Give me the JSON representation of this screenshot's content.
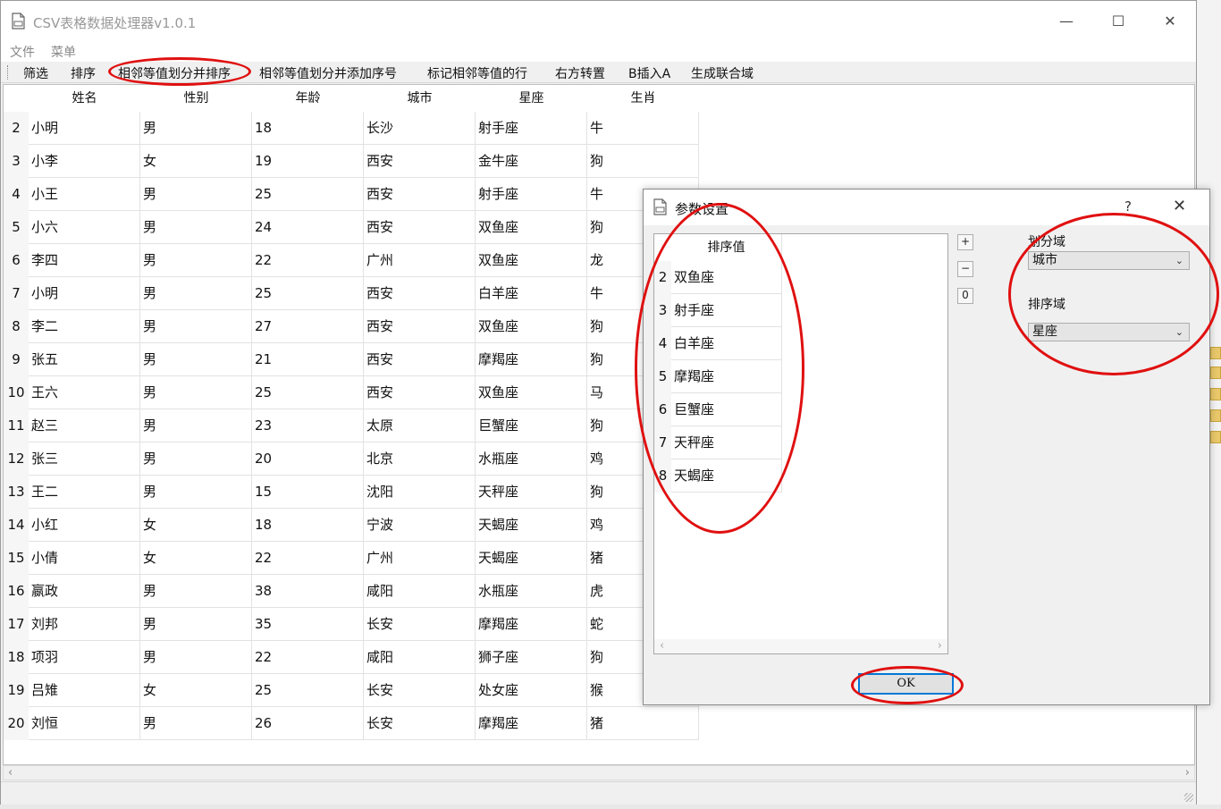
{
  "window": {
    "title": "CSV表格数据处理器v1.0.1",
    "controls": {
      "minimize": "—",
      "maximize": "☐",
      "close": "✕"
    }
  },
  "menu": [
    "文件",
    "菜单"
  ],
  "toolbar": [
    "筛选",
    "排序",
    "相邻等值划分并排序",
    "相邻等值划分并添加序号",
    "标记相邻等值的行",
    "右方转置",
    "B插入A",
    "生成联合域"
  ],
  "table": {
    "columns": [
      "姓名",
      "性别",
      "年龄",
      "城市",
      "星座",
      "生肖"
    ],
    "rows": [
      {
        "num": "2",
        "cells": [
          "小明",
          "男",
          "18",
          "长沙",
          "射手座",
          "牛"
        ]
      },
      {
        "num": "3",
        "cells": [
          "小李",
          "女",
          "19",
          "西安",
          "金牛座",
          "狗"
        ]
      },
      {
        "num": "4",
        "cells": [
          "小王",
          "男",
          "25",
          "西安",
          "射手座",
          "牛"
        ]
      },
      {
        "num": "5",
        "cells": [
          "小六",
          "男",
          "24",
          "西安",
          "双鱼座",
          "狗"
        ]
      },
      {
        "num": "6",
        "cells": [
          "李四",
          "男",
          "22",
          "广州",
          "双鱼座",
          "龙"
        ]
      },
      {
        "num": "7",
        "cells": [
          "小明",
          "男",
          "25",
          "西安",
          "白羊座",
          "牛"
        ]
      },
      {
        "num": "8",
        "cells": [
          "李二",
          "男",
          "27",
          "西安",
          "双鱼座",
          "狗"
        ]
      },
      {
        "num": "9",
        "cells": [
          "张五",
          "男",
          "21",
          "西安",
          "摩羯座",
          "狗"
        ]
      },
      {
        "num": "10",
        "cells": [
          "王六",
          "男",
          "25",
          "西安",
          "双鱼座",
          "马"
        ]
      },
      {
        "num": "11",
        "cells": [
          "赵三",
          "男",
          "23",
          "太原",
          "巨蟹座",
          "狗"
        ]
      },
      {
        "num": "12",
        "cells": [
          "张三",
          "男",
          "20",
          "北京",
          "水瓶座",
          "鸡"
        ]
      },
      {
        "num": "13",
        "cells": [
          "王二",
          "男",
          "15",
          "沈阳",
          "天秤座",
          "狗"
        ]
      },
      {
        "num": "14",
        "cells": [
          "小红",
          "女",
          "18",
          "宁波",
          "天蝎座",
          "鸡"
        ]
      },
      {
        "num": "15",
        "cells": [
          "小倩",
          "女",
          "22",
          "广州",
          "天蝎座",
          "猪"
        ]
      },
      {
        "num": "16",
        "cells": [
          "嬴政",
          "男",
          "38",
          "咸阳",
          "水瓶座",
          "虎"
        ]
      },
      {
        "num": "17",
        "cells": [
          "刘邦",
          "男",
          "35",
          "长安",
          "摩羯座",
          "蛇"
        ]
      },
      {
        "num": "18",
        "cells": [
          "项羽",
          "男",
          "22",
          "咸阳",
          "狮子座",
          "狗"
        ]
      },
      {
        "num": "19",
        "cells": [
          "吕雉",
          "女",
          "25",
          "长安",
          "处女座",
          "猴"
        ]
      },
      {
        "num": "20",
        "cells": [
          "刘恒",
          "男",
          "26",
          "长安",
          "摩羯座",
          "猪"
        ]
      }
    ]
  },
  "dialog": {
    "title": "参数设置",
    "help": "?",
    "close": "✕",
    "list_header": "排序值",
    "list_rows": [
      {
        "num": "2",
        "value": "双鱼座"
      },
      {
        "num": "3",
        "value": "射手座"
      },
      {
        "num": "4",
        "value": "白羊座"
      },
      {
        "num": "5",
        "value": "摩羯座"
      },
      {
        "num": "6",
        "value": "巨蟹座"
      },
      {
        "num": "7",
        "value": "天秤座"
      },
      {
        "num": "8",
        "value": "天蝎座"
      }
    ],
    "buttons": {
      "add": "+",
      "remove": "−",
      "zero": "0"
    },
    "partition_label": "划分域",
    "partition_value": "城市",
    "sort_label": "排序域",
    "sort_value": "星座",
    "ok": "OK"
  },
  "icons": {
    "app": "document-icon",
    "dropdown": "chevron-down-icon"
  },
  "colors": {
    "annotation": "#e01010",
    "focus_border": "#0078d7"
  }
}
